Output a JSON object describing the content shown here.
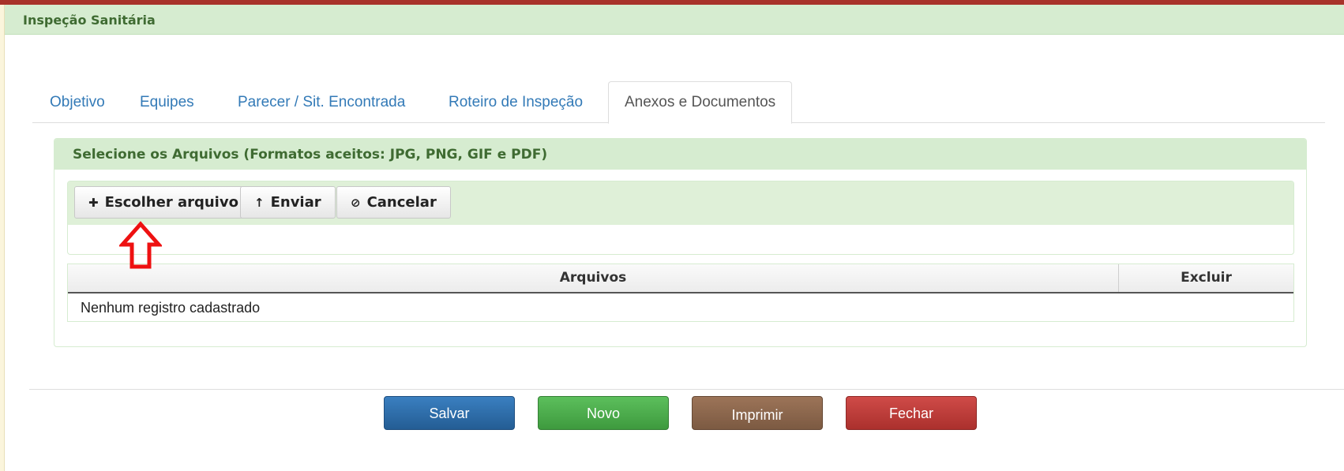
{
  "colors": {
    "header_bg": "#d6ecd0",
    "header_text": "#3f6b32",
    "link": "#337ab7",
    "top_strip": "#a8322a",
    "annotation_arrow": "#ee1111",
    "salvar": "#2d6ca8",
    "novo": "#4cae4c",
    "imprimir": "#8b654b",
    "fechar": "#c13b38"
  },
  "page": {
    "title": "Inspeção Sanitária"
  },
  "tabs": [
    {
      "label": "Objetivo",
      "active": false
    },
    {
      "label": "Equipes",
      "active": false
    },
    {
      "label": "Parecer / Sit. Encontrada",
      "active": false
    },
    {
      "label": "Roteiro de Inspeção",
      "active": false
    },
    {
      "label": "Anexos e Documentos",
      "active": true
    }
  ],
  "upload_panel": {
    "title": "Selecione os Arquivos (Formatos aceitos: JPG, PNG, GIF e PDF)",
    "buttons": {
      "choose": {
        "label": "Escolher arquivo",
        "icon": "plus-icon"
      },
      "send": {
        "label": "Enviar",
        "icon": "upload-arrow-icon"
      },
      "cancel": {
        "label": "Cancelar",
        "icon": "cancel-icon"
      }
    }
  },
  "files_table": {
    "columns": [
      "Arquivos",
      "Excluir"
    ],
    "empty_message": "Nenhum registro cadastrado"
  },
  "actions": {
    "salvar": "Salvar",
    "novo": "Novo",
    "imprimir": "Imprimir",
    "fechar": "Fechar"
  }
}
